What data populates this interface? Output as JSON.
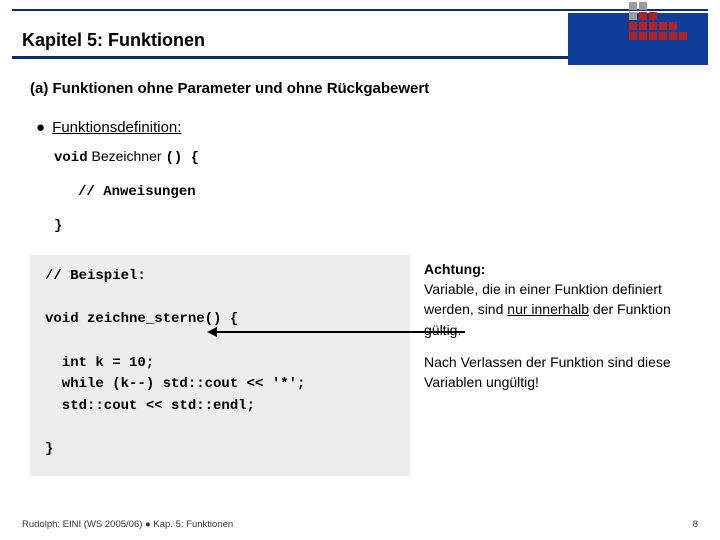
{
  "header": {
    "chapter_title": "Kapitel 5: Funktionen"
  },
  "section": {
    "heading": "(a) Funktionen ohne Parameter und ohne Rückgabewert",
    "bullet_label": "Funktionsdefinition:",
    "proto_void": "void",
    "proto_name": " Bezeichner ",
    "proto_parens": "()",
    "proto_brace": "  {",
    "proto_body": "// Anweisungen",
    "proto_close": "}"
  },
  "code": {
    "line1": "// Beispiel:",
    "line2_blank": "",
    "line3": "void zeichne_sterne() {",
    "line4_blank": "",
    "line5": "  int k = 10;",
    "line6": "  while (k--) std::cout << '*';",
    "line7": "  std::cout << std::endl;",
    "line8_blank": "",
    "line9": "}"
  },
  "note": {
    "heading": "Achtung:",
    "p1a": "Variable, die in einer Funktion definiert werden, sind ",
    "p1u": "nur innerhalb",
    "p1b": " der Funktion gültig.",
    "p2": "Nach Verlassen der Funktion sind diese Variablen ungültig!"
  },
  "footer": {
    "left": "Rudolph: EINI (WS 2005/06) ● Kap. 5: Funktionen",
    "page": "8"
  }
}
